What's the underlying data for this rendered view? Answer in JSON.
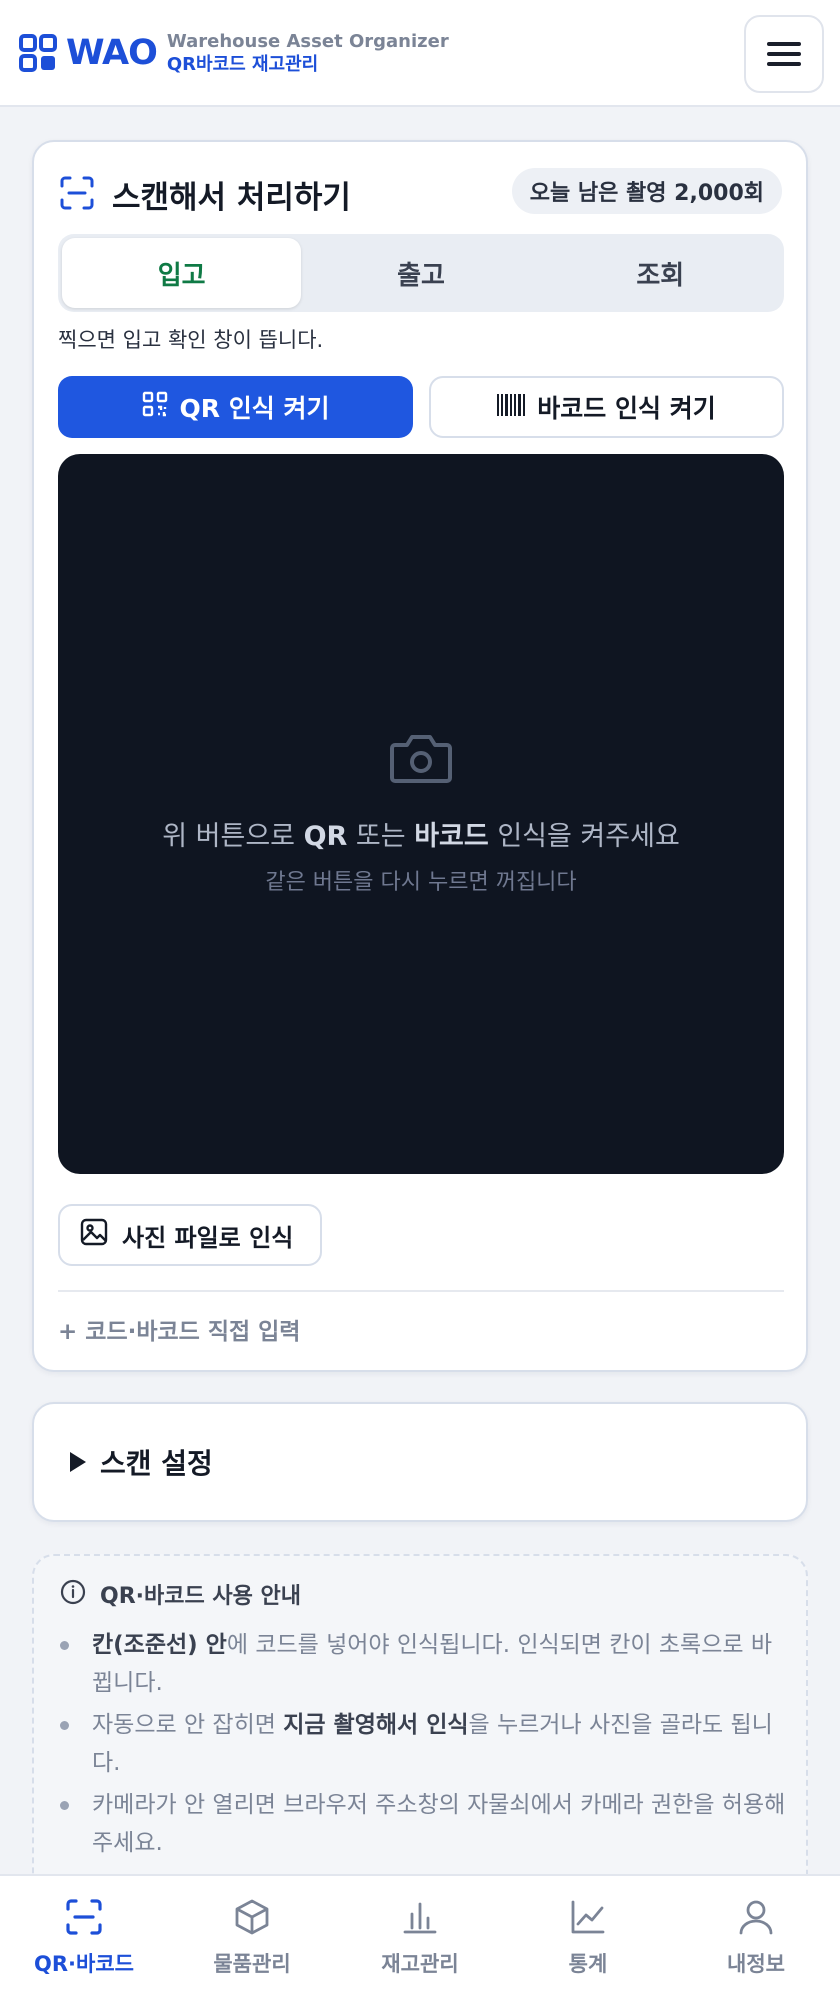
{
  "header": {
    "logo_text": "WAO",
    "subtitle_en": "Warehouse Asset Organizer",
    "subtitle_ko": "QR바코드 재고관리",
    "menu_icon": "hamburger-icon"
  },
  "scan_card": {
    "title": "스캔해서 처리하기",
    "remaining_badge": "오늘 남은 촬영 2,000회",
    "tabs": [
      {
        "label": "입고",
        "active": true
      },
      {
        "label": "출고",
        "active": false
      },
      {
        "label": "조회",
        "active": false
      }
    ],
    "tab_help": "찍으면 입고 확인 창이 뜹니다.",
    "qr_button": "QR 인식 켜기",
    "barcode_button": "바코드 인식 켜기",
    "camera": {
      "msg_pre": "위 버튼으로 ",
      "msg_qr": "QR",
      "msg_mid": " 또는 ",
      "msg_barcode": "바코드",
      "msg_post": " 인식을 켜주세요",
      "sub": "같은 버튼을 다시 누르면 꺼집니다"
    },
    "photo_button": "사진 파일로 인식",
    "direct_input_link": "+ 코드·바코드 직접 입력"
  },
  "settings": {
    "title": "스캔 설정"
  },
  "guide": {
    "title": "QR·바코드 사용 안내",
    "items": [
      {
        "bold": "칸(조준선) 안",
        "text": "에 코드를 넣어야 인식됩니다. 인식되면 칸이 초록으로 바뀝니다."
      },
      {
        "pre": "자동으로 안 잡히면 ",
        "bold": "지금 촬영해서 인식",
        "text": "을 누르거나 사진을 골라도 됩니다."
      },
      {
        "text": "카메라가 안 열리면 브라우저 주소창의 자물쇠에서 카메라 권한을 허용해주세요."
      }
    ]
  },
  "tabbar": {
    "items": [
      {
        "label": "QR·바코드",
        "icon": "scan-icon",
        "active": true
      },
      {
        "label": "물품관리",
        "icon": "box-icon",
        "active": false
      },
      {
        "label": "재고관리",
        "icon": "bar-chart-icon",
        "active": false
      },
      {
        "label": "통계",
        "icon": "line-chart-icon",
        "active": false
      },
      {
        "label": "내정보",
        "icon": "user-icon",
        "active": false
      }
    ]
  },
  "colors": {
    "brand": "#1d4fd8",
    "primary_button": "#1f57e0",
    "active_tab_text": "#0f7a45",
    "camera_bg": "#0f1521"
  }
}
